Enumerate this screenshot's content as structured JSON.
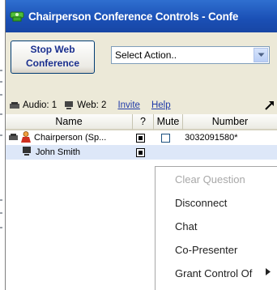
{
  "window": {
    "title": "Chairperson Conference Controls - Confe"
  },
  "toolbar": {
    "stop_button_line1": "Stop Web",
    "stop_button_line2": "Conference",
    "select_value": "Select Action.."
  },
  "status": {
    "audio_label": "Audio: 1",
    "web_label": "Web: 2",
    "invite_link": "Invite",
    "help_link": "Help"
  },
  "grid": {
    "columns": [
      "Name",
      "?",
      "Mute",
      "Number"
    ],
    "rows": [
      {
        "name": "Chairperson (Sp...",
        "number": "3032091580*",
        "muted": false
      },
      {
        "name": "John Smith",
        "number": "",
        "muted": null
      }
    ]
  },
  "context_menu": {
    "items": [
      {
        "label": "Clear Question",
        "enabled": false
      },
      {
        "label": "Disconnect",
        "enabled": true
      },
      {
        "label": "Chat",
        "enabled": true
      },
      {
        "label": "Co-Presenter",
        "enabled": true
      },
      {
        "label": "Grant Control Of",
        "enabled": true,
        "submenu": true
      }
    ]
  },
  "icons": {
    "app": "conference-icon",
    "audio": "phone-icon",
    "web": "computer-icon",
    "popout": "popout-icon",
    "chairperson": "presenter-icon",
    "participant": "computer-icon",
    "question": "question-icon",
    "dropdown": "chevron-down-icon",
    "submenu": "caret-right-icon"
  },
  "colors": {
    "titlebar": "#1a4fb5",
    "link": "#1f3aa8",
    "button_text": "#1a2f8f",
    "selected_row": "#dde7f8",
    "disabled_text": "#a8a8a8"
  }
}
